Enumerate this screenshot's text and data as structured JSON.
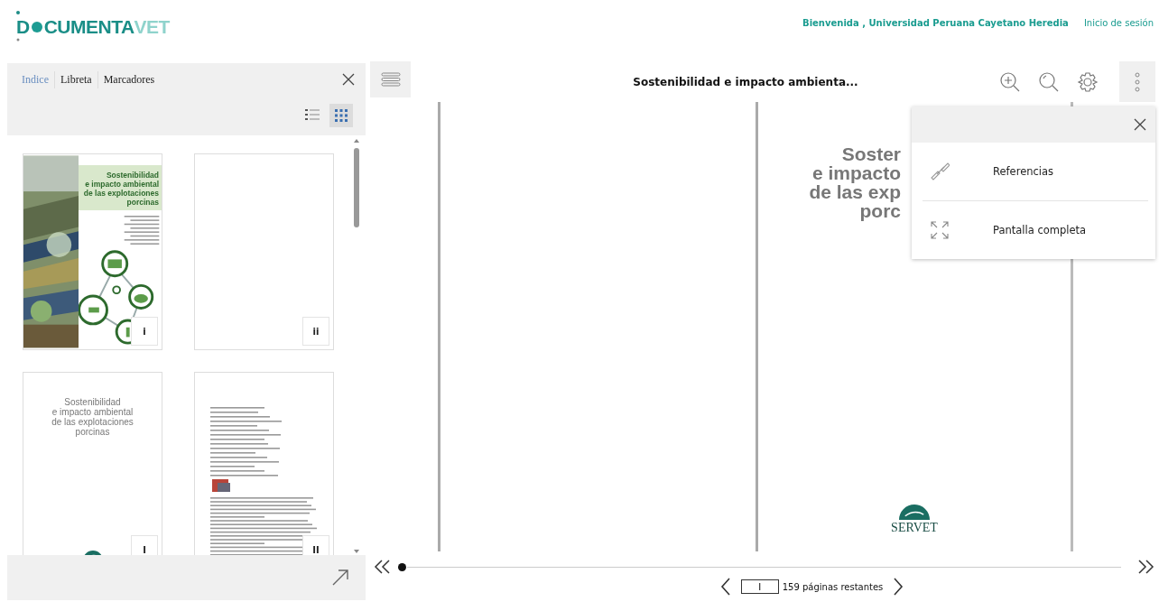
{
  "header": {
    "logo": {
      "lead": "D",
      "middle": "CUMENTA",
      "accent": "VET"
    },
    "welcome": "Bienvenida , Universidad Peruana Cayetano Heredia",
    "login": "Inicio de sesión"
  },
  "sidebar": {
    "tabs": [
      {
        "label": "Indice",
        "selected": true
      },
      {
        "label": "Libreta",
        "selected": false
      },
      {
        "label": "Marcadores",
        "selected": false
      }
    ],
    "view_modes": [
      {
        "kind": "list",
        "selected": false
      },
      {
        "kind": "grid",
        "selected": true
      }
    ],
    "thumbnails": [
      {
        "kind": "cover",
        "title_lines": [
          "Sostenibilidad",
          "e impacto ambiental",
          "de las explotaciones",
          "porcinas"
        ],
        "page_label": "i"
      },
      {
        "kind": "blank",
        "page_label": "ii"
      },
      {
        "kind": "title",
        "title_lines": [
          "Sostenibilidad",
          "e impacto ambiental",
          "de las explotaciones",
          "porcinas"
        ],
        "page_label": "I"
      },
      {
        "kind": "text",
        "page_label": "II"
      }
    ]
  },
  "viewer": {
    "title": "Sostenibilidad e impacto ambienta...",
    "pages": [
      {
        "kind": "blank"
      },
      {
        "kind": "title",
        "title_lines": [
          "Soster",
          "e impacto",
          "de las exp",
          "porc"
        ],
        "publisher": "SERVET"
      }
    ]
  },
  "menu": {
    "items": [
      {
        "kind": "link",
        "label": "Referencias"
      },
      {
        "kind": "fullscreen",
        "label": "Pantalla completa"
      }
    ]
  },
  "pager": {
    "slider": {
      "level": 0
    },
    "page_value": "I",
    "remaining": "159 páginas restantes"
  }
}
